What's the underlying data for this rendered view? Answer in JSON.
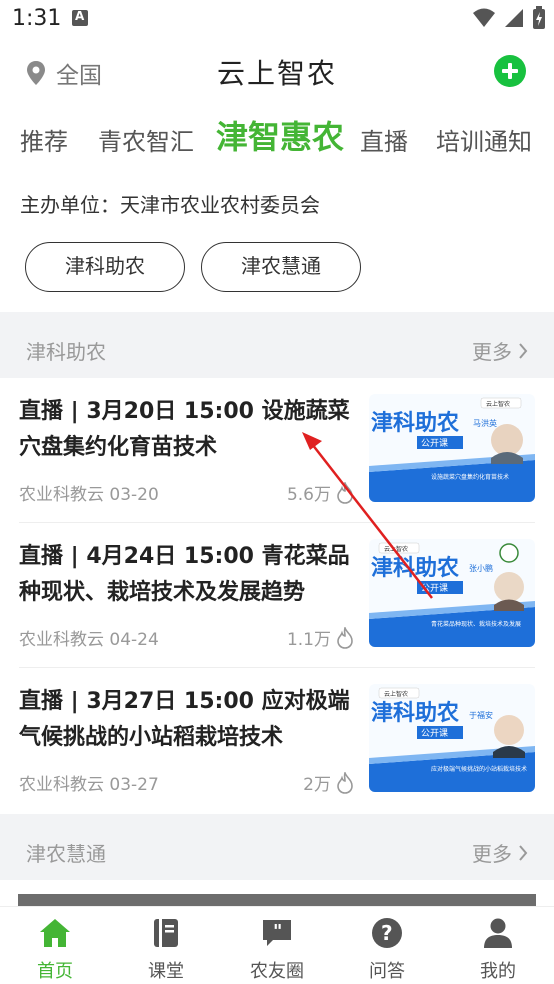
{
  "status_bar": {
    "time": "1:31"
  },
  "header": {
    "location": "全国",
    "title": "云上智农"
  },
  "tabs": [
    {
      "label": "推荐"
    },
    {
      "label": "青农智汇"
    },
    {
      "label": "津智惠农"
    },
    {
      "label": "直播"
    },
    {
      "label": "培训通知"
    }
  ],
  "org": {
    "text": "主办单位：天津市农业农村委员会"
  },
  "chips": [
    {
      "label": "津科助农"
    },
    {
      "label": "津农慧通"
    }
  ],
  "section1": {
    "title": "津科助农",
    "more": "更多"
  },
  "cards": [
    {
      "title": "直播 | 3月20日 15:00 设施蔬菜穴盘集约化育苗技术",
      "source": "农业科教云 03-20",
      "views": "5.6万",
      "thumb": {
        "logo": "云上智农",
        "brand": "津科助农",
        "sub": "公开课",
        "speaker": "马洪英",
        "topic": "设施蔬菜穴盘集约化育苗技术"
      }
    },
    {
      "title": "直播 | 4月24日 15:00 青花菜品种现状、栽培技术及发展趋势",
      "source": "农业科教云 04-24",
      "views": "1.1万",
      "thumb": {
        "logo": "云上智农",
        "brand": "津科助农",
        "sub": "公开课",
        "speaker": "张小鹏",
        "topic": "青花菜品种现状、栽培技术及发展"
      }
    },
    {
      "title": "直播 | 3月27日 15:00 应对极端气候挑战的小站稻栽培技术",
      "source": "农业科教云 03-27",
      "views": "2万",
      "thumb": {
        "logo": "云上智农",
        "brand": "津科助农",
        "sub": "公开课",
        "speaker": "于福安",
        "topic": "应对极端气候挑战的小站稻栽培技术"
      }
    }
  ],
  "section2": {
    "title": "津农慧通",
    "more": "更多"
  },
  "bottom_nav": [
    {
      "label": "首页",
      "icon": "home-icon"
    },
    {
      "label": "课堂",
      "icon": "book-icon"
    },
    {
      "label": "农友圈",
      "icon": "quote-bubble-icon"
    },
    {
      "label": "问答",
      "icon": "question-icon"
    },
    {
      "label": "我的",
      "icon": "user-icon"
    }
  ],
  "colors": {
    "accent": "#44b535",
    "add": "#18c13f",
    "annotation": "#e02020",
    "thumb_blue": "#1e6fd9"
  }
}
